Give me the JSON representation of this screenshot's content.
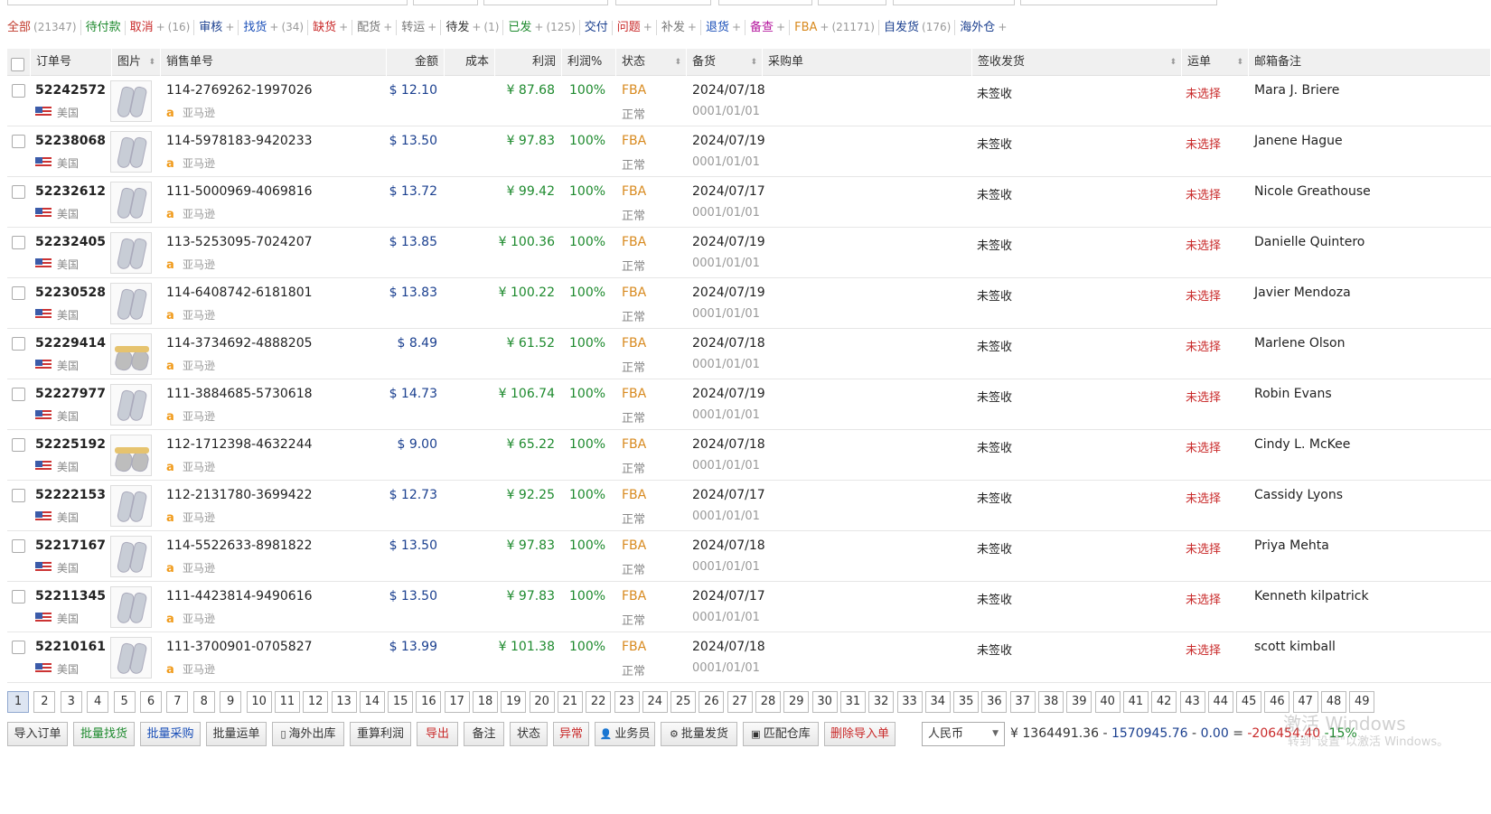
{
  "tabs": [
    {
      "label": "全部",
      "count": "(21347)",
      "color": "#c0392b",
      "plus": false
    },
    {
      "label": "待付款",
      "count": "",
      "color": "#1e8a2e",
      "plus": false
    },
    {
      "label": "取消",
      "count": "(16)",
      "color": "#c92a2a",
      "plus": true
    },
    {
      "label": "审核",
      "count": "",
      "color": "#1a3f8f",
      "plus": true
    },
    {
      "label": "找货",
      "count": "(34)",
      "color": "#1a4fb8",
      "plus": true
    },
    {
      "label": "缺货",
      "count": "",
      "color": "#c92a2a",
      "plus": true
    },
    {
      "label": "配货",
      "count": "",
      "color": "#777777",
      "plus": true
    },
    {
      "label": "转运",
      "count": "",
      "color": "#777777",
      "plus": true
    },
    {
      "label": "待发",
      "count": "(1)",
      "color": "#333333",
      "plus": true
    },
    {
      "label": "已发",
      "count": "(125)",
      "color": "#1e8a2e",
      "plus": true
    },
    {
      "label": "交付",
      "count": "",
      "color": "#1a3f8f",
      "plus": false
    },
    {
      "label": "问题",
      "count": "",
      "color": "#c92a2a",
      "plus": true
    },
    {
      "label": "补发",
      "count": "",
      "color": "#777777",
      "plus": true
    },
    {
      "label": "退货",
      "count": "",
      "color": "#1a4fb8",
      "plus": true
    },
    {
      "label": "备查",
      "count": "",
      "color": "#b5179e",
      "plus": true
    },
    {
      "label": "FBA",
      "count": "(21171)",
      "color": "#d88a1f",
      "plus": true
    },
    {
      "label": "自发货",
      "count": "(176)",
      "color": "#1a3f8f",
      "plus": false
    },
    {
      "label": "海外仓",
      "count": "",
      "color": "#1a3f8f",
      "plus": true
    }
  ],
  "columns": {
    "order_id": "订单号",
    "image": "图片",
    "sale_no": "销售单号",
    "amount": "金额",
    "cost": "成本",
    "profit": "利润",
    "margin": "利润%",
    "status": "状态",
    "stock": "备货",
    "purchase": "采购单",
    "sign_ship": "签收发货",
    "waybill": "运单",
    "email_note": "邮箱备注"
  },
  "rows": [
    {
      "id": "52242572",
      "country": "美国",
      "sale": "114-2769262-1997026",
      "platform": "亚马逊",
      "amount": "$ 12.10",
      "profit": "¥ 87.68",
      "pct": "100%",
      "status": "FBA",
      "state2": "正常",
      "date": "2024/07/18",
      "date2": "0001/01/01",
      "sign": "未签收",
      "ship": "未选择",
      "cust": "Mara J. Briere",
      "img": "sock"
    },
    {
      "id": "52238068",
      "country": "美国",
      "sale": "114-5978183-9420233",
      "platform": "亚马逊",
      "amount": "$ 13.50",
      "profit": "¥ 97.83",
      "pct": "100%",
      "status": "FBA",
      "state2": "正常",
      "date": "2024/07/19",
      "date2": "0001/01/01",
      "sign": "未签收",
      "ship": "未选择",
      "cust": "Janene Hague",
      "img": "sock"
    },
    {
      "id": "52232612",
      "country": "美国",
      "sale": "111-5000969-4069816",
      "platform": "亚马逊",
      "amount": "$ 13.72",
      "profit": "¥ 99.42",
      "pct": "100%",
      "status": "FBA",
      "state2": "正常",
      "date": "2024/07/17",
      "date2": "0001/01/01",
      "sign": "未签收",
      "ship": "未选择",
      "cust": "Nicole Greathouse",
      "img": "sock"
    },
    {
      "id": "52232405",
      "country": "美国",
      "sale": "113-5253095-7024207",
      "platform": "亚马逊",
      "amount": "$ 13.85",
      "profit": "¥ 100.36",
      "pct": "100%",
      "status": "FBA",
      "state2": "正常",
      "date": "2024/07/19",
      "date2": "0001/01/01",
      "sign": "未签收",
      "ship": "未选择",
      "cust": "Danielle Quintero",
      "img": "sock"
    },
    {
      "id": "52230528",
      "country": "美国",
      "sale": "114-6408742-6181801",
      "platform": "亚马逊",
      "amount": "$ 13.83",
      "profit": "¥ 100.22",
      "pct": "100%",
      "status": "FBA",
      "state2": "正常",
      "date": "2024/07/19",
      "date2": "0001/01/01",
      "sign": "未签收",
      "ship": "未选择",
      "cust": "Javier Mendoza",
      "img": "sock"
    },
    {
      "id": "52229414",
      "country": "美国",
      "sale": "114-3734692-4888205",
      "platform": "亚马逊",
      "amount": "$ 8.49",
      "profit": "¥ 61.52",
      "pct": "100%",
      "status": "FBA",
      "state2": "正常",
      "date": "2024/07/18",
      "date2": "0001/01/01",
      "sign": "未签收",
      "ship": "未选择",
      "cust": "Marlene Olson",
      "img": "alt"
    },
    {
      "id": "52227977",
      "country": "美国",
      "sale": "111-3884685-5730618",
      "platform": "亚马逊",
      "amount": "$ 14.73",
      "profit": "¥ 106.74",
      "pct": "100%",
      "status": "FBA",
      "state2": "正常",
      "date": "2024/07/19",
      "date2": "0001/01/01",
      "sign": "未签收",
      "ship": "未选择",
      "cust": "Robin Evans",
      "img": "sock"
    },
    {
      "id": "52225192",
      "country": "美国",
      "sale": "112-1712398-4632244",
      "platform": "亚马逊",
      "amount": "$ 9.00",
      "profit": "¥ 65.22",
      "pct": "100%",
      "status": "FBA",
      "state2": "正常",
      "date": "2024/07/18",
      "date2": "0001/01/01",
      "sign": "未签收",
      "ship": "未选择",
      "cust": "Cindy L. McKee",
      "img": "alt"
    },
    {
      "id": "52222153",
      "country": "美国",
      "sale": "112-2131780-3699422",
      "platform": "亚马逊",
      "amount": "$ 12.73",
      "profit": "¥ 92.25",
      "pct": "100%",
      "status": "FBA",
      "state2": "正常",
      "date": "2024/07/17",
      "date2": "0001/01/01",
      "sign": "未签收",
      "ship": "未选择",
      "cust": "Cassidy Lyons",
      "img": "sock"
    },
    {
      "id": "52217167",
      "country": "美国",
      "sale": "114-5522633-8981822",
      "platform": "亚马逊",
      "amount": "$ 13.50",
      "profit": "¥ 97.83",
      "pct": "100%",
      "status": "FBA",
      "state2": "正常",
      "date": "2024/07/18",
      "date2": "0001/01/01",
      "sign": "未签收",
      "ship": "未选择",
      "cust": "Priya Mehta",
      "img": "sock"
    },
    {
      "id": "52211345",
      "country": "美国",
      "sale": "111-4423814-9490616",
      "platform": "亚马逊",
      "amount": "$ 13.50",
      "profit": "¥ 97.83",
      "pct": "100%",
      "status": "FBA",
      "state2": "正常",
      "date": "2024/07/17",
      "date2": "0001/01/01",
      "sign": "未签收",
      "ship": "未选择",
      "cust": "Kenneth kilpatrick",
      "img": "sock"
    },
    {
      "id": "52210161",
      "country": "美国",
      "sale": "111-3700901-0705827",
      "platform": "亚马逊",
      "amount": "$ 13.99",
      "profit": "¥ 101.38",
      "pct": "100%",
      "status": "FBA",
      "state2": "正常",
      "date": "2024/07/18",
      "date2": "0001/01/01",
      "sign": "未签收",
      "ship": "未选择",
      "cust": "scott kimball",
      "img": "sock"
    }
  ],
  "pages": [
    "1",
    "2",
    "3",
    "4",
    "5",
    "6",
    "7",
    "8",
    "9",
    "10",
    "11",
    "12",
    "13",
    "14",
    "15",
    "16",
    "17",
    "18",
    "19",
    "20",
    "21",
    "22",
    "23",
    "24",
    "25",
    "26",
    "27",
    "28",
    "29",
    "30",
    "31",
    "32",
    "33",
    "34",
    "35",
    "36",
    "37",
    "38",
    "39",
    "40",
    "41",
    "42",
    "43",
    "44",
    "45",
    "46",
    "47",
    "48",
    "49"
  ],
  "current_page": "1",
  "actions": [
    {
      "label": "导入订单",
      "cls": "",
      "icon": ""
    },
    {
      "label": "批量找货",
      "cls": "c-green",
      "icon": ""
    },
    {
      "label": "批量采购",
      "cls": "c-blue",
      "icon": ""
    },
    {
      "label": "批量运单",
      "cls": "",
      "icon": ""
    },
    {
      "label": "海外出库",
      "cls": "",
      "icon": "▯"
    },
    {
      "label": "重算利润",
      "cls": "",
      "icon": ""
    },
    {
      "label": "导出",
      "cls": "c-red",
      "icon": ""
    },
    {
      "label": "备注",
      "cls": "",
      "icon": ""
    },
    {
      "label": "状态",
      "cls": "",
      "icon": ""
    },
    {
      "label": "异常",
      "cls": "c-red",
      "icon": ""
    },
    {
      "label": "业务员",
      "cls": "",
      "icon": "👤"
    },
    {
      "label": "批量发货",
      "cls": "",
      "icon": "⚙"
    },
    {
      "label": "匹配仓库",
      "cls": "",
      "icon": "▣"
    },
    {
      "label": "删除导入单",
      "cls": "c-red",
      "icon": ""
    }
  ],
  "currency": "人民币",
  "summary": {
    "sym": "¥",
    "a": "1364491.36",
    "op1": "-",
    "b": "1570945.76",
    "op2": "-",
    "c": "0.00",
    "eq": "=",
    "d": "-206454.40",
    "e": "-15%"
  },
  "watermark": {
    "line1": "激活 Windows",
    "line2": "转到\"设置\"以激活 Windows。"
  }
}
